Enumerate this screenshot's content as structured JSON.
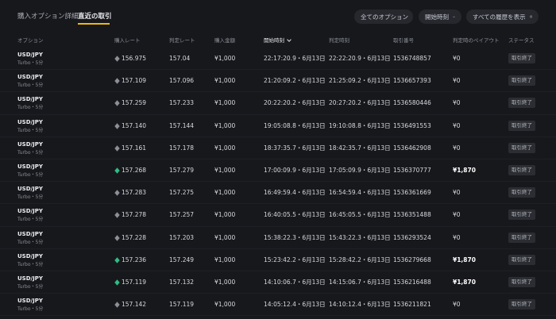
{
  "tabs": [
    {
      "label": "購入オプション詳細",
      "active": false
    },
    {
      "label": "直近の取引",
      "active": true
    }
  ],
  "filters": {
    "options_label": "全てのオプション",
    "time_label": "開始時刻",
    "history_label": "すべての履歴を表示"
  },
  "colors": {
    "accent": "#f0b90b",
    "win": "#2ebd85",
    "neutral_icon": "#8b8f98"
  },
  "columns": {
    "option": "オプション",
    "purchase_rate": "購入レート",
    "judge_rate": "判定レート",
    "amount": "購入金額",
    "start_time": "開始時刻",
    "judge_time": "判定時刻",
    "trade_no": "取引番号",
    "payout": "判定時のペイアウト",
    "status": "ステータス"
  },
  "trades": [
    {
      "pair": "USD/JPY",
      "sub": "Turbo・5分",
      "result": "lose",
      "purchase_rate": "156.975",
      "judge_rate": "157.04",
      "amount": "¥1,000",
      "start": "22:17:20.9・6月13日",
      "judge": "22:22:20.9・6月13日",
      "trade_no": "1536748857",
      "payout": "¥0",
      "status": "取引終了"
    },
    {
      "pair": "USD/JPY",
      "sub": "Turbo・5分",
      "result": "lose",
      "purchase_rate": "157.109",
      "judge_rate": "157.096",
      "amount": "¥1,000",
      "start": "21:20:09.2・6月13日",
      "judge": "21:25:09.2・6月13日",
      "trade_no": "1536657393",
      "payout": "¥0",
      "status": "取引終了"
    },
    {
      "pair": "USD/JPY",
      "sub": "Turbo・5分",
      "result": "lose",
      "purchase_rate": "157.259",
      "judge_rate": "157.233",
      "amount": "¥1,000",
      "start": "20:22:20.2・6月13日",
      "judge": "20:27:20.2・6月13日",
      "trade_no": "1536580446",
      "payout": "¥0",
      "status": "取引終了"
    },
    {
      "pair": "USD/JPY",
      "sub": "Turbo・5分",
      "result": "lose",
      "purchase_rate": "157.140",
      "judge_rate": "157.144",
      "amount": "¥1,000",
      "start": "19:05:08.8・6月13日",
      "judge": "19:10:08.8・6月13日",
      "trade_no": "1536491553",
      "payout": "¥0",
      "status": "取引終了"
    },
    {
      "pair": "USD/JPY",
      "sub": "Turbo・5分",
      "result": "lose",
      "purchase_rate": "157.161",
      "judge_rate": "157.178",
      "amount": "¥1,000",
      "start": "18:37:35.7・6月13日",
      "judge": "18:42:35.7・6月13日",
      "trade_no": "1536462908",
      "payout": "¥0",
      "status": "取引終了"
    },
    {
      "pair": "USD/JPY",
      "sub": "Turbo・5分",
      "result": "win",
      "purchase_rate": "157.268",
      "judge_rate": "157.279",
      "amount": "¥1,000",
      "start": "17:00:09.9・6月13日",
      "judge": "17:05:09.9・6月13日",
      "trade_no": "1536370777",
      "payout": "¥1,870",
      "status": "取引終了"
    },
    {
      "pair": "USD/JPY",
      "sub": "Turbo・5分",
      "result": "lose",
      "purchase_rate": "157.283",
      "judge_rate": "157.275",
      "amount": "¥1,000",
      "start": "16:49:59.4・6月13日",
      "judge": "16:54:59.4・6月13日",
      "trade_no": "1536361669",
      "payout": "¥0",
      "status": "取引終了"
    },
    {
      "pair": "USD/JPY",
      "sub": "Turbo・5分",
      "result": "lose",
      "purchase_rate": "157.278",
      "judge_rate": "157.257",
      "amount": "¥1,000",
      "start": "16:40:05.5・6月13日",
      "judge": "16:45:05.5・6月13日",
      "trade_no": "1536351488",
      "payout": "¥0",
      "status": "取引終了"
    },
    {
      "pair": "USD/JPY",
      "sub": "Turbo・5分",
      "result": "lose",
      "purchase_rate": "157.228",
      "judge_rate": "157.203",
      "amount": "¥1,000",
      "start": "15:38:22.3・6月13日",
      "judge": "15:43:22.3・6月13日",
      "trade_no": "1536293524",
      "payout": "¥0",
      "status": "取引終了"
    },
    {
      "pair": "USD/JPY",
      "sub": "Turbo・5分",
      "result": "win",
      "purchase_rate": "157.236",
      "judge_rate": "157.249",
      "amount": "¥1,000",
      "start": "15:23:42.2・6月13日",
      "judge": "15:28:42.2・6月13日",
      "trade_no": "1536279668",
      "payout": "¥1,870",
      "status": "取引終了"
    },
    {
      "pair": "USD/JPY",
      "sub": "Turbo・5分",
      "result": "win",
      "purchase_rate": "157.119",
      "judge_rate": "157.132",
      "amount": "¥1,000",
      "start": "14:10:06.7・6月13日",
      "judge": "14:15:06.7・6月13日",
      "trade_no": "1536216488",
      "payout": "¥1,870",
      "status": "取引終了"
    },
    {
      "pair": "USD/JPY",
      "sub": "Turbo・5分",
      "result": "lose",
      "purchase_rate": "157.142",
      "judge_rate": "157.119",
      "amount": "¥1,000",
      "start": "14:05:12.4・6月13日",
      "judge": "14:10:12.4・6月13日",
      "trade_no": "1536211821",
      "payout": "¥0",
      "status": "取引終了"
    }
  ]
}
